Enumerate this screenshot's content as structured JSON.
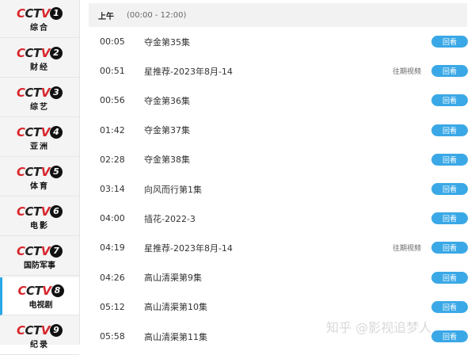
{
  "channels": [
    {
      "number": "1",
      "name": "综合",
      "active": false
    },
    {
      "number": "2",
      "name": "财经",
      "active": false
    },
    {
      "number": "3",
      "name": "综艺",
      "active": false
    },
    {
      "number": "4",
      "name": "亚洲",
      "active": false
    },
    {
      "number": "5",
      "name": "体育",
      "active": false
    },
    {
      "number": "6",
      "name": "电影",
      "active": false
    },
    {
      "number": "7",
      "name": "国防军事",
      "active": false
    },
    {
      "number": "8",
      "name": "电视剧",
      "active": true
    },
    {
      "number": "9",
      "name": "纪录",
      "active": false
    }
  ],
  "logo_word": "CCTV",
  "period": {
    "label": "上午",
    "range": "(00:00 - 12:00)"
  },
  "programs": [
    {
      "time": "00:05",
      "title": "夺金第35集",
      "tag": "",
      "button": "回看"
    },
    {
      "time": "00:51",
      "title": "星推荐-2023年8月-14",
      "tag": "往期视频",
      "button": "回看"
    },
    {
      "time": "00:56",
      "title": "夺金第36集",
      "tag": "",
      "button": "回看"
    },
    {
      "time": "01:42",
      "title": "夺金第37集",
      "tag": "",
      "button": "回看"
    },
    {
      "time": "02:28",
      "title": "夺金第38集",
      "tag": "",
      "button": "回看"
    },
    {
      "time": "03:14",
      "title": "向风而行第1集",
      "tag": "",
      "button": "回看"
    },
    {
      "time": "04:00",
      "title": "插花-2022-3",
      "tag": "",
      "button": "回看"
    },
    {
      "time": "04:19",
      "title": "星推荐-2023年8月-14",
      "tag": "往期视频",
      "button": "回看"
    },
    {
      "time": "04:26",
      "title": "高山清渠第9集",
      "tag": "",
      "button": "回看"
    },
    {
      "time": "05:12",
      "title": "高山清渠第10集",
      "tag": "",
      "button": "回看"
    },
    {
      "time": "05:58",
      "title": "高山清渠第11集",
      "tag": "",
      "button": "回看"
    }
  ],
  "watermark": "知乎 @影视追梦人",
  "colors": {
    "accent": "#3aa8e6",
    "active_border": "#2aa7e8",
    "logo_red": "#d8262c"
  }
}
